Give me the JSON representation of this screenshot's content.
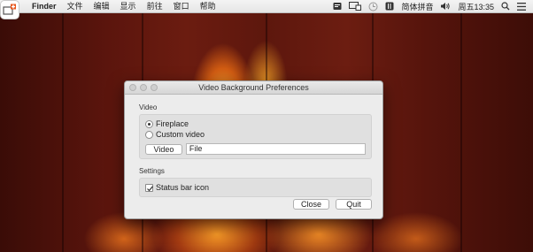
{
  "menubar": {
    "app_name": "Finder",
    "items": [
      "文件",
      "编辑",
      "显示",
      "前往",
      "窗口",
      "帮助"
    ],
    "input_method": "简体拼音",
    "clock": "周五13:35"
  },
  "window": {
    "title": "Video Background Preferences",
    "video_section": {
      "label": "Video",
      "options": [
        {
          "label": "Fireplace",
          "selected": true
        },
        {
          "label": "Custom video",
          "selected": false
        }
      ],
      "video_button": "Video",
      "file_value": "File"
    },
    "settings_section": {
      "label": "Settings",
      "status_bar_icon": {
        "label": "Status bar icon",
        "checked": true
      }
    },
    "buttons": {
      "close": "Close",
      "quit": "Quit"
    }
  },
  "colors": {
    "menubar_bg": "#ececec",
    "window_bg": "#ececec",
    "app_icon_accent": "#e8541a"
  },
  "icons": [
    "app-icon",
    "notification-icon",
    "screen-mirror-icon",
    "time-machine-icon",
    "input-method-icon",
    "volume-icon",
    "search-icon",
    "menu-list-icon"
  ]
}
